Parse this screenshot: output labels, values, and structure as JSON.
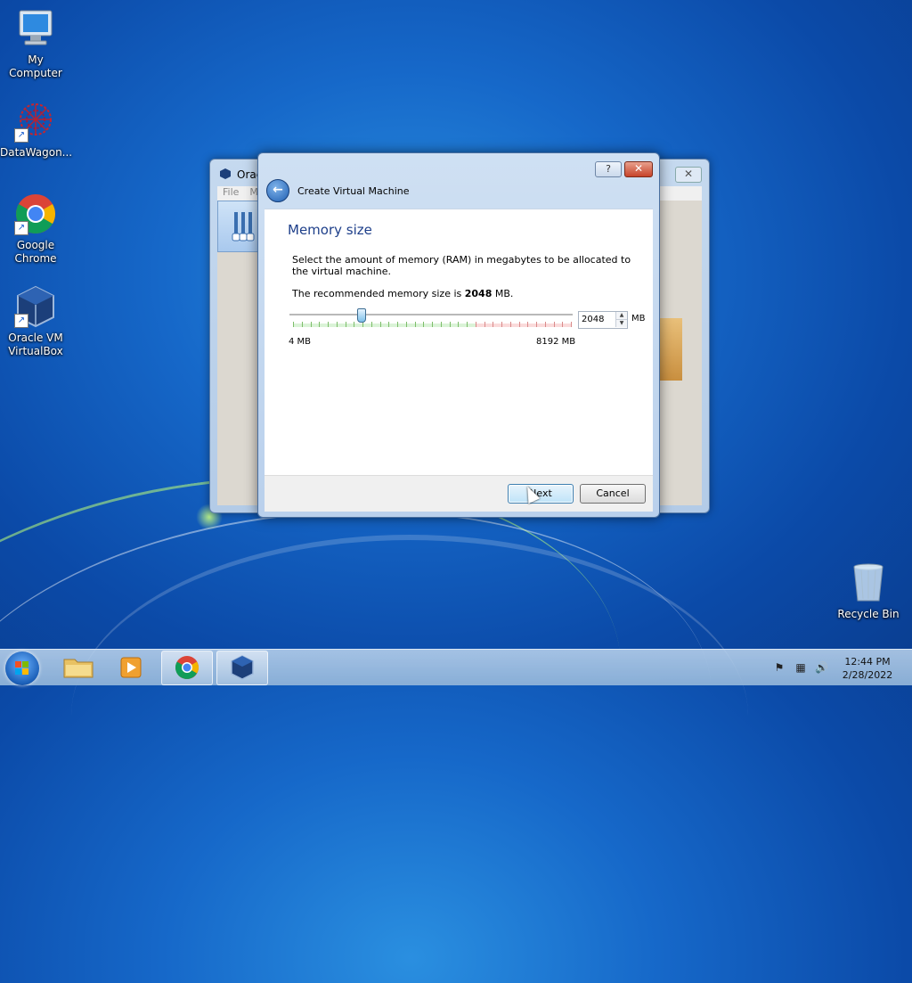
{
  "desktop": {
    "icons": [
      {
        "label": "My Computer"
      },
      {
        "label": "DataWagon..."
      },
      {
        "label": "Google Chrome"
      },
      {
        "label": "Oracle VM VirtualBox"
      },
      {
        "label": "Recycle Bin"
      }
    ]
  },
  "background_window": {
    "title": "Orac",
    "menu": [
      "File",
      "Ma"
    ]
  },
  "dialog": {
    "title": "Create Virtual Machine",
    "help_label": "?",
    "close_label": "✕",
    "heading": "Memory size",
    "description": "Select the amount of memory (RAM) in megabytes to be allocated to the virtual machine.",
    "recommend_prefix": "The recommended memory size is ",
    "recommend_value": "2048",
    "recommend_suffix": " MB.",
    "slider": {
      "min_label": "4 MB",
      "max_label": "8192 MB",
      "value": 2048,
      "min": 4,
      "max": 8192
    },
    "memory_input_value": "2048",
    "unit_label": "MB",
    "next_label": "Next",
    "cancel_label": "Cancel"
  },
  "taskbar": {
    "items": [
      "start",
      "explorer",
      "media-player",
      "chrome",
      "virtualbox"
    ],
    "active_item": "chrome",
    "clock_time": "12:44 PM",
    "clock_date": "2/28/2022"
  }
}
